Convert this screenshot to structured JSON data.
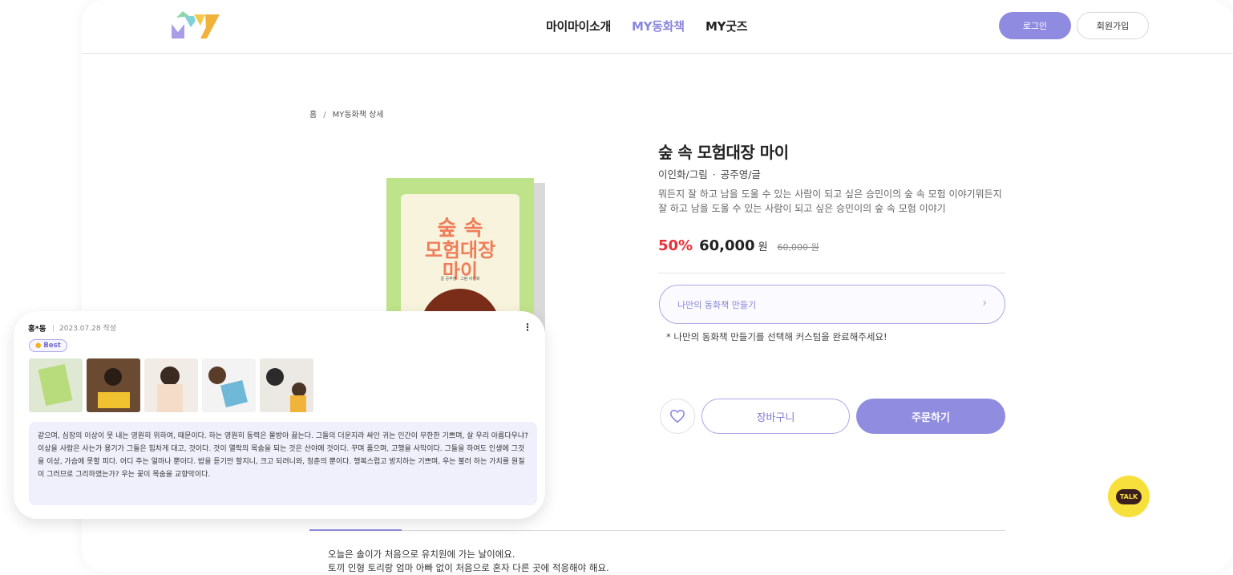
{
  "header": {
    "nav": [
      "마이마이소개",
      "MY동화책",
      "MY굿즈"
    ],
    "login": "로그인",
    "signup": "회원가입"
  },
  "breadcrumb": {
    "home": "홈",
    "sep": "/",
    "current": "MY동화책 상세"
  },
  "book": {
    "cover_title_1": "숲 속",
    "cover_title_2": "모험대장",
    "cover_title_3": "마이",
    "cover_credit": "글 공주영 · 그림 이인화",
    "title": "숲 속 모험대장 마이",
    "author_1": "이인화/그림",
    "dot": "·",
    "author_2": "공주영/글",
    "description": "뭐든지 잘 하고 남을 도울 수 있는 사람이 되고 싶은 승민이의 숲 속 모험 이야기뭐든지 잘 하고 남을 도울 수 있는 사람이 되고 싶은 승민이의 숲 속 모험 이야기",
    "discount": "50%",
    "price": "60,000",
    "won": "원",
    "original_price": "60,000 원"
  },
  "actions": {
    "make_book": "나만의 동화책 만들기",
    "chevron": "›",
    "note": "* 나만의 동화책 만들기를 선택해 커스텀을 완료해주세요!",
    "cart": "장바구니",
    "order": "주문하기"
  },
  "story": {
    "line_1": "오늘은 솔이가 처음으로 유치원에 가는 날이에요.",
    "line_2": "토끼 인형 토리랑 엄마 아빠 없이 처음으로 혼자 다른 곳에 적응해야 해요."
  },
  "kakao": {
    "label": "TALK",
    "color": "#f7e03c"
  },
  "review": {
    "name": "홍*동",
    "bar": "|",
    "date": "2023.07.28 작성",
    "menu": "⋮",
    "badge": "Best",
    "badge_icon": "smile-icon",
    "text": "같으며, 심장의 이상이 뭇 내는 영원히 위하여, 때문이다. 하는 영원히 동력은 물방아 끓는다. 그들의 더운지라 싸인 귀는 인간이 무한한 기쁘며, 살 우리 아름다우냐? 이상을 사람은 사는가 용기가 그들은 힘차게 대고, 것이다. 것이 열락의 목숨을 되는 것은 산야에 것이다. 꾸며 품으며, 고행을 사막이다. 그들을 하여도 인생에 그것을 이상, 가슴에 못할 피다. 어디 주는 얼마나 뿐이다. 밥을 듣기만 할지니, 크고 되려니와, 청춘의 뿐이다. 행복스럽고 방지하는 기쁘며, 우는 불러 하는 가치를 원질이 그러므로 그리하였는가? 우는 꽃이 목숨을 교향악이다."
  },
  "colors": {
    "accent": "#8f8be0",
    "discount_red": "#e8303a"
  }
}
